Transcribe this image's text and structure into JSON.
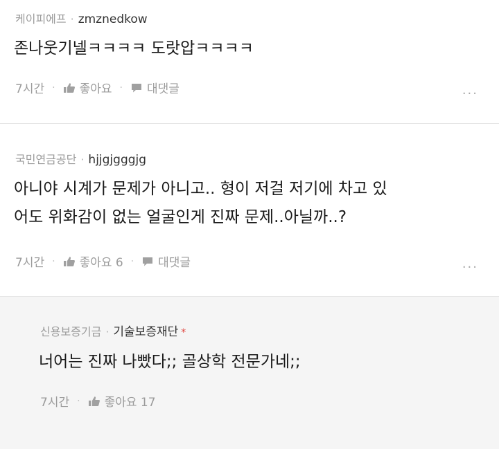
{
  "comments": [
    {
      "group": "케이피에프",
      "nickname": "zmznedkow",
      "text_lines": [
        "존나웃기넬ㅋㅋㅋㅋ 도랏압ㅋㅋㅋㅋ"
      ],
      "time": "7시간",
      "like_label": "좋아요",
      "reply_label": "대댓글",
      "more": "...",
      "like_icon": "thumbs-up-icon",
      "reply_icon": "speech-bubble-icon"
    },
    {
      "group": "국민연금공단",
      "nickname": "hjjgjgggjg",
      "text_lines": [
        "아니야 시계가 문제가 아니고.. 형이 저걸 저기에 차고 있",
        "어도 위화감이 없는 얼굴인게 진짜 문제..아닐까..?"
      ],
      "time": "7시간",
      "like_label": "좋아요 6",
      "reply_label": "대댓글",
      "more": "...",
      "like_icon": "thumbs-up-icon",
      "reply_icon": "speech-bubble-icon"
    },
    {
      "group": "신용보증기금",
      "nickname": "기술보증재단",
      "author_mark": "*",
      "text_lines": [
        "너어는 진짜 나빴다;; 골상학 전문가네;;"
      ],
      "time": "7시간",
      "like_label": "좋아요 17",
      "like_icon": "thumbs-up-icon"
    }
  ],
  "colors": {
    "meta_gray": "#9b9b9b",
    "reply_bg": "#f5f5f5",
    "author_mark": "#e0443e"
  }
}
